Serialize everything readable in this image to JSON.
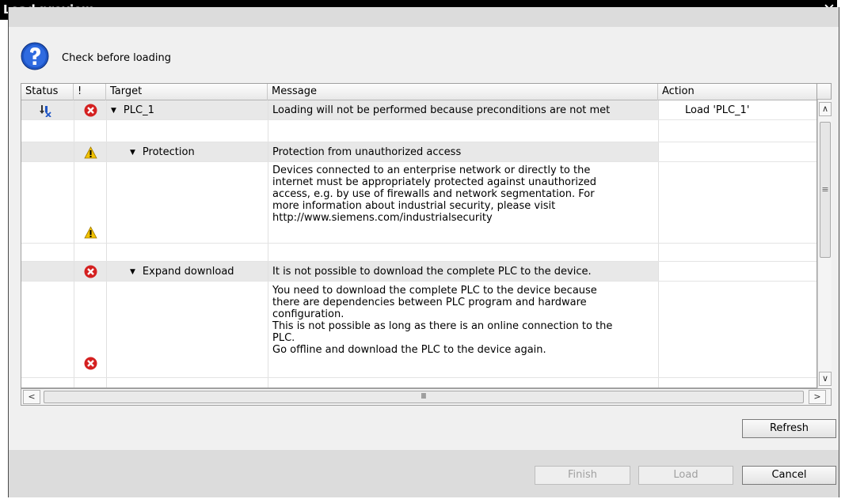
{
  "window": {
    "title": "Load preview",
    "close_symbol": "✕"
  },
  "header": {
    "text": "Check before loading",
    "icon": "question-icon"
  },
  "grid": {
    "columns": [
      "Status",
      "!",
      "Target",
      "Message",
      "Action"
    ],
    "rows": [
      {
        "status_icon": "download-error-icon",
        "severity": "error",
        "target": "PLC_1",
        "message": "Loading will not be performed because preconditions are not met",
        "action": "Load 'PLC_1'"
      },
      {
        "severity": "warning",
        "target": "Protection",
        "message": "Protection from unauthorized access"
      },
      {
        "severity": "warning",
        "message_lines": [
          "Devices connected to an enterprise network or directly to the",
          "internet must be appropriately protected against unauthorized",
          "access, e.g. by use of firewalls and network segmentation. For",
          "more information about industrial security, please visit",
          "http://www.siemens.com/industrialsecurity"
        ]
      },
      {
        "severity": "error",
        "target": "Expand download",
        "message": "It is not possible to download the complete PLC to the device."
      },
      {
        "severity": "error",
        "message_lines": [
          "You need to download the complete PLC to the device because",
          "there are dependencies between PLC program and hardware",
          "configuration.",
          "This is not possible as long as there is an online connection to the",
          "PLC.",
          "Go offline and download the PLC to the device again."
        ]
      }
    ]
  },
  "colors": {
    "error": "#d42020",
    "warning": "#f2c200",
    "question": "#1f56c6"
  },
  "buttons": {
    "refresh": "Refresh",
    "finish": "Finish",
    "load": "Load",
    "cancel": "Cancel"
  },
  "scroll": {
    "up": "∧",
    "down": "∨",
    "left": "<",
    "right": ">",
    "vgrip": "≡",
    "hgrip": "Ⅲ"
  }
}
